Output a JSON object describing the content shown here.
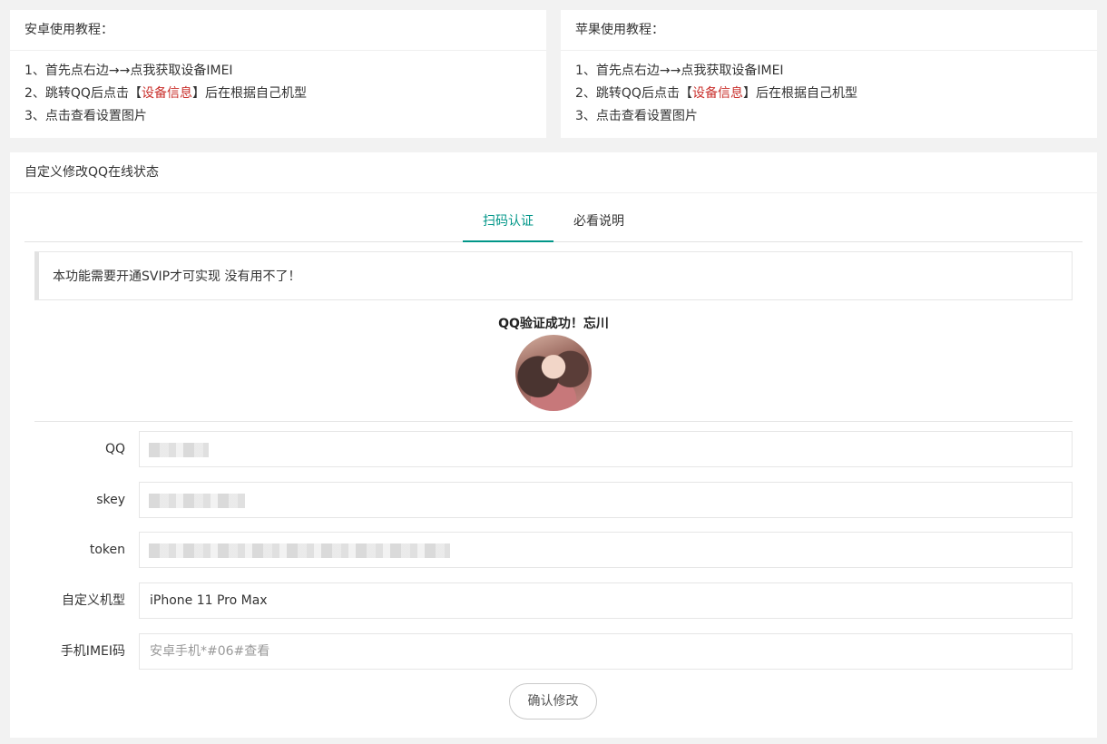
{
  "android": {
    "title": "安卓使用教程：",
    "steps": [
      {
        "text": "1、首先点右边→→点我获取设备IMEI"
      },
      {
        "pre": "2、跳转QQ后点击【",
        "highlight": "设备信息",
        "post": "】后在根据自己机型"
      },
      {
        "text": "3、点击查看设置图片"
      }
    ]
  },
  "apple": {
    "title": "苹果使用教程：",
    "steps": [
      {
        "text": "1、首先点右边→→点我获取设备IMEI"
      },
      {
        "pre": "2、跳转QQ后点击【",
        "highlight": "设备信息",
        "post": "】后在根据自己机型"
      },
      {
        "text": "3、点击查看设置图片"
      }
    ]
  },
  "main": {
    "title": "自定义修改QQ在线状态",
    "tabs": [
      {
        "label": "扫码认证",
        "active": true
      },
      {
        "label": "必看说明",
        "active": false
      }
    ],
    "notice": "本功能需要开通SVIP才可实现 没有用不了！",
    "verify_message": "QQ验证成功！忘川"
  },
  "form": {
    "qq": {
      "label": "QQ",
      "value": ""
    },
    "skey": {
      "label": "skey",
      "value": ""
    },
    "token": {
      "label": "token",
      "value": ""
    },
    "model": {
      "label": "自定义机型",
      "value": "iPhone 11 Pro Max"
    },
    "imei": {
      "label": "手机IMEI码",
      "placeholder": "安卓手机*#06#查看"
    }
  },
  "confirm_label": "确认修改",
  "colors": {
    "accent": "#009688",
    "highlight": "#c9302c",
    "background": "#f2f2f2"
  }
}
